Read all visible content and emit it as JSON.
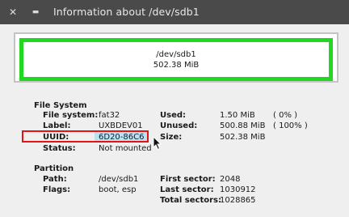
{
  "window": {
    "title": "Information about /dev/sdb1",
    "close_glyph": "✕",
    "menu_glyph": "▬"
  },
  "usage_bar": {
    "path": "/dev/sdb1",
    "size": "502.38 MiB",
    "border_color": "#1fd81f"
  },
  "file_system": {
    "heading": "File System",
    "rows": [
      {
        "label": "File system:",
        "value": "fat32"
      },
      {
        "label": "Label:",
        "value": "UXBDEV01"
      },
      {
        "label": "UUID:",
        "value": "6D20-86C6"
      },
      {
        "label": "Status:",
        "value": "Not mounted"
      }
    ],
    "usage_rows": [
      {
        "label": "Used:",
        "value": "1.50 MiB",
        "pct": "( 0% )"
      },
      {
        "label": "Unused:",
        "value": "500.88 MiB",
        "pct": "( 100% )"
      },
      {
        "label": "Size:",
        "value": "502.38 MiB",
        "pct": ""
      }
    ]
  },
  "partition": {
    "heading": "Partition",
    "rows": [
      {
        "label": "Path:",
        "value": "/dev/sdb1"
      },
      {
        "label": "Flags:",
        "value": "boot, esp"
      }
    ],
    "sector_rows": [
      {
        "label": "First sector:",
        "value": "2048"
      },
      {
        "label": "Last sector:",
        "value": "1030912"
      },
      {
        "label": "Total sectors:",
        "value": "1028865"
      }
    ]
  },
  "highlight_color": "#e41414"
}
